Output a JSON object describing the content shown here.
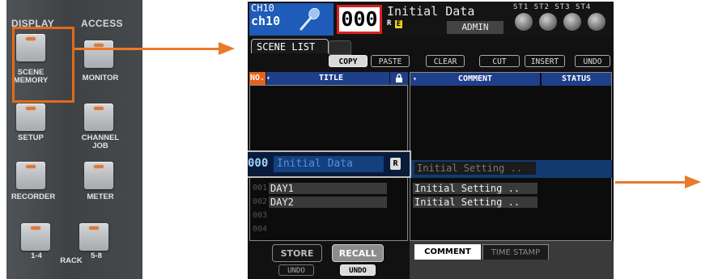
{
  "panel": {
    "header_left": "DISPLAY",
    "header_right": "ACCESS",
    "buttons": [
      {
        "label_line1": "SCENE",
        "label_line2": "MEMORY"
      },
      {
        "label_line1": "MONITOR",
        "label_line2": ""
      },
      {
        "label_line1": "SETUP",
        "label_line2": ""
      },
      {
        "label_line1": "CHANNEL",
        "label_line2": "JOB"
      },
      {
        "label_line1": "RECORDER",
        "label_line2": ""
      },
      {
        "label_line1": "METER",
        "label_line2": ""
      },
      {
        "label_line1": "1-4",
        "label_line2": ""
      },
      {
        "label_line1": "5-8",
        "label_line2": ""
      }
    ],
    "rack_label": "RACK"
  },
  "screen": {
    "channel_id": "CH10",
    "channel_name": "ch10",
    "scene_number": "000",
    "scene_title": "Initial Data",
    "r_badge": "R",
    "e_badge": "E",
    "user": "ADMIN",
    "stereo_labels": "ST1 ST2 ST3 ST4",
    "tab_label": "SCENE LIST",
    "toolbar": [
      "COPY",
      "PASTE",
      "CLEAR",
      "CUT",
      "INSERT",
      "UNDO"
    ],
    "columns": {
      "no": "NO.",
      "title": "TITLE",
      "comment": "COMMENT",
      "status": "STATUS"
    },
    "selected": {
      "number": "000",
      "title": "Initial Data",
      "badge": "R",
      "comment": "Initial Setting .."
    },
    "rows": [
      {
        "no": "001",
        "title": "DAY1",
        "comment": "Initial Setting .."
      },
      {
        "no": "002",
        "title": "DAY2",
        "comment": "Initial Setting .."
      },
      {
        "no": "003",
        "title": "",
        "comment": ""
      },
      {
        "no": "004",
        "title": "",
        "comment": ""
      }
    ],
    "store_label": "STORE",
    "recall_label": "RECALL",
    "undo_label": "UNDO",
    "bottom_tabs": [
      "COMMENT",
      "TIME STAMP"
    ]
  },
  "colors": {
    "accent": "#e87a2a",
    "selection": "#1f3f8a",
    "scene_box": "#d8231f"
  }
}
